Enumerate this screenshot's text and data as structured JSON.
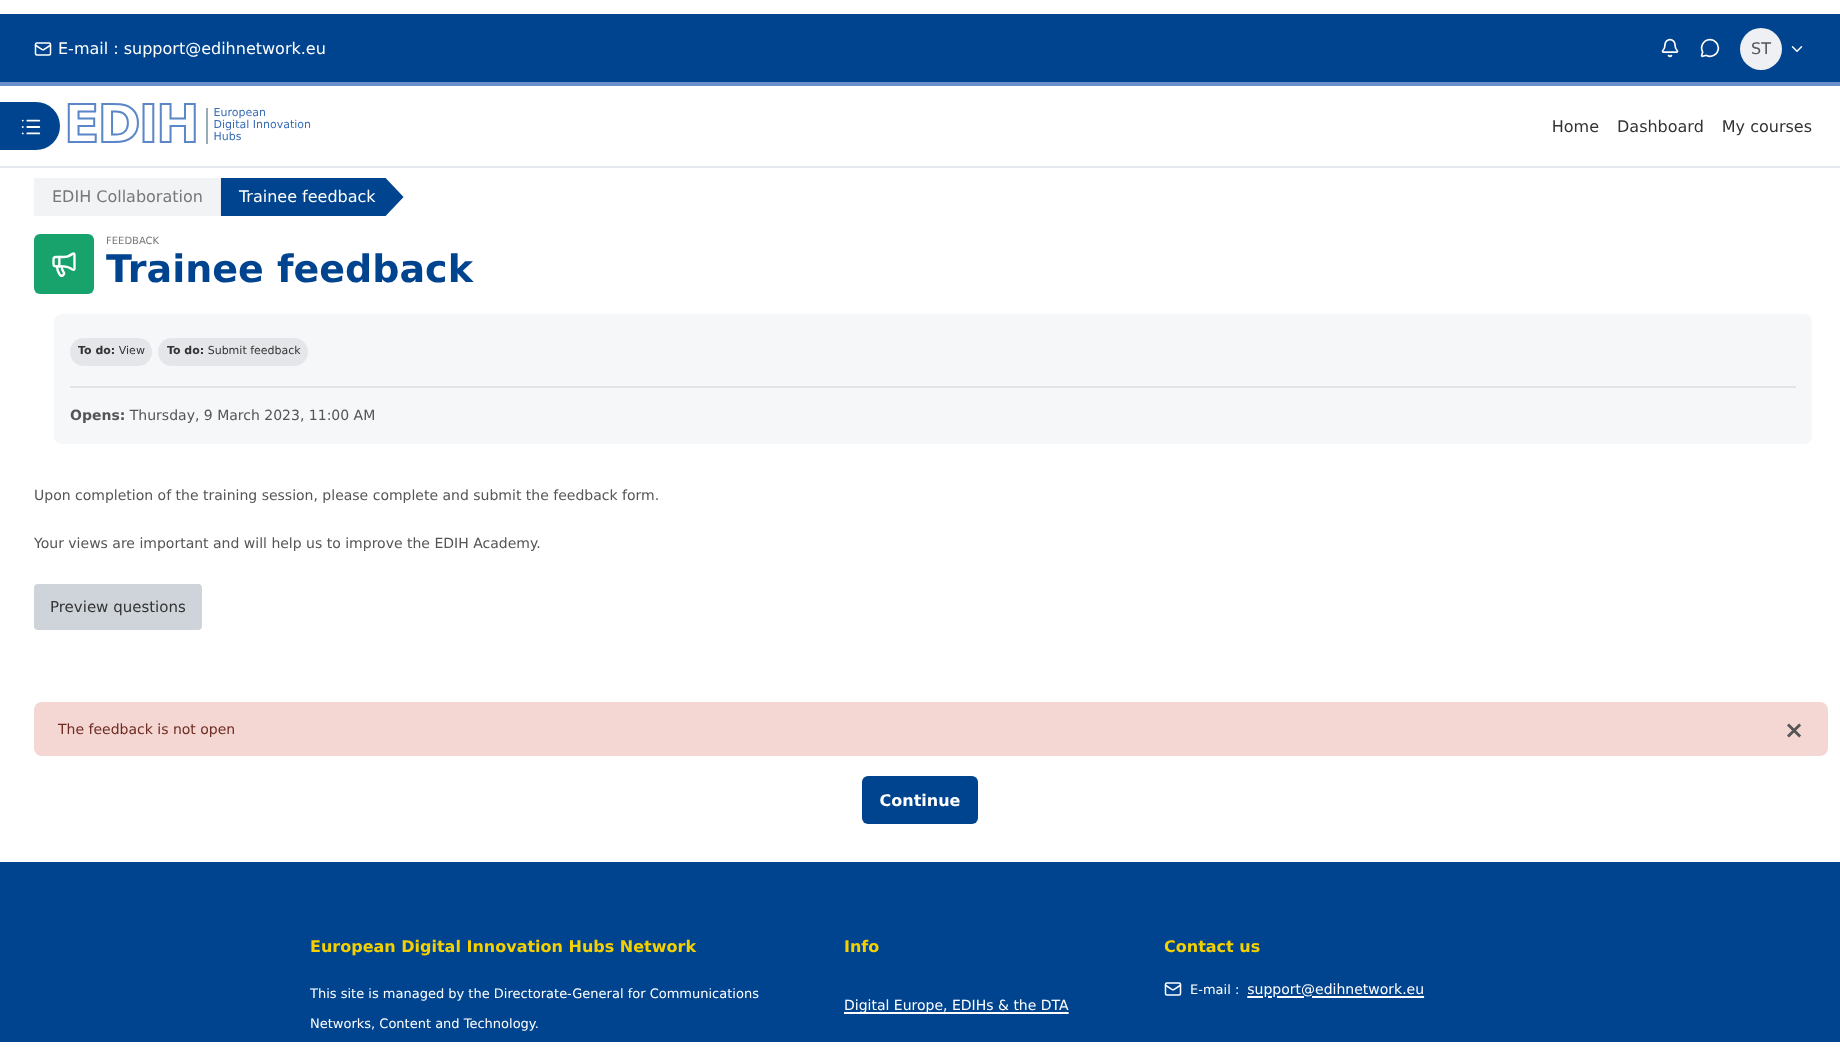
{
  "top_bar": {
    "email_label": "E-mail : support@edihnetwork.eu",
    "avatar_initials": "ST"
  },
  "navbar": {
    "logo_mark": "EDIH",
    "logo_lines": [
      "European",
      "Digital Innovation",
      "Hubs"
    ],
    "links": [
      {
        "label": "Home"
      },
      {
        "label": "Dashboard"
      },
      {
        "label": "My courses"
      }
    ]
  },
  "breadcrumb": [
    {
      "label": "EDIH Collaboration",
      "selected": false
    },
    {
      "label": "Trainee feedback",
      "selected": true
    }
  ],
  "activity": {
    "kind_label": "FEEDBACK",
    "title": "Trainee feedback"
  },
  "dates_card": {
    "todos": [
      {
        "prefix": "To do:",
        "label": "View"
      },
      {
        "prefix": "To do:",
        "label": "Submit feedback"
      }
    ],
    "opens_label": "Opens:",
    "opens_value": "Thursday, 9 March 2023, 11:00 AM"
  },
  "intro": [
    "Upon completion of the training session, please complete and submit the feedback form.",
    "Your views are important and will help us to improve the EDIH Academy."
  ],
  "preview_button": "Preview questions",
  "alert": {
    "message": "The feedback is not open",
    "close": "×"
  },
  "continue_button": "Continue",
  "footer": {
    "columns": [
      {
        "heading": "European Digital Innovation Hubs Network",
        "text": "This site is managed by the Directorate-General for Communications Networks, Content and Technology."
      },
      {
        "heading": "Info",
        "link": "Digital Europe, EDIHs & the DTA"
      },
      {
        "heading": "Contact us",
        "email_prefix": "E-mail :",
        "email_link": "support@edihnetwork.eu"
      }
    ]
  }
}
